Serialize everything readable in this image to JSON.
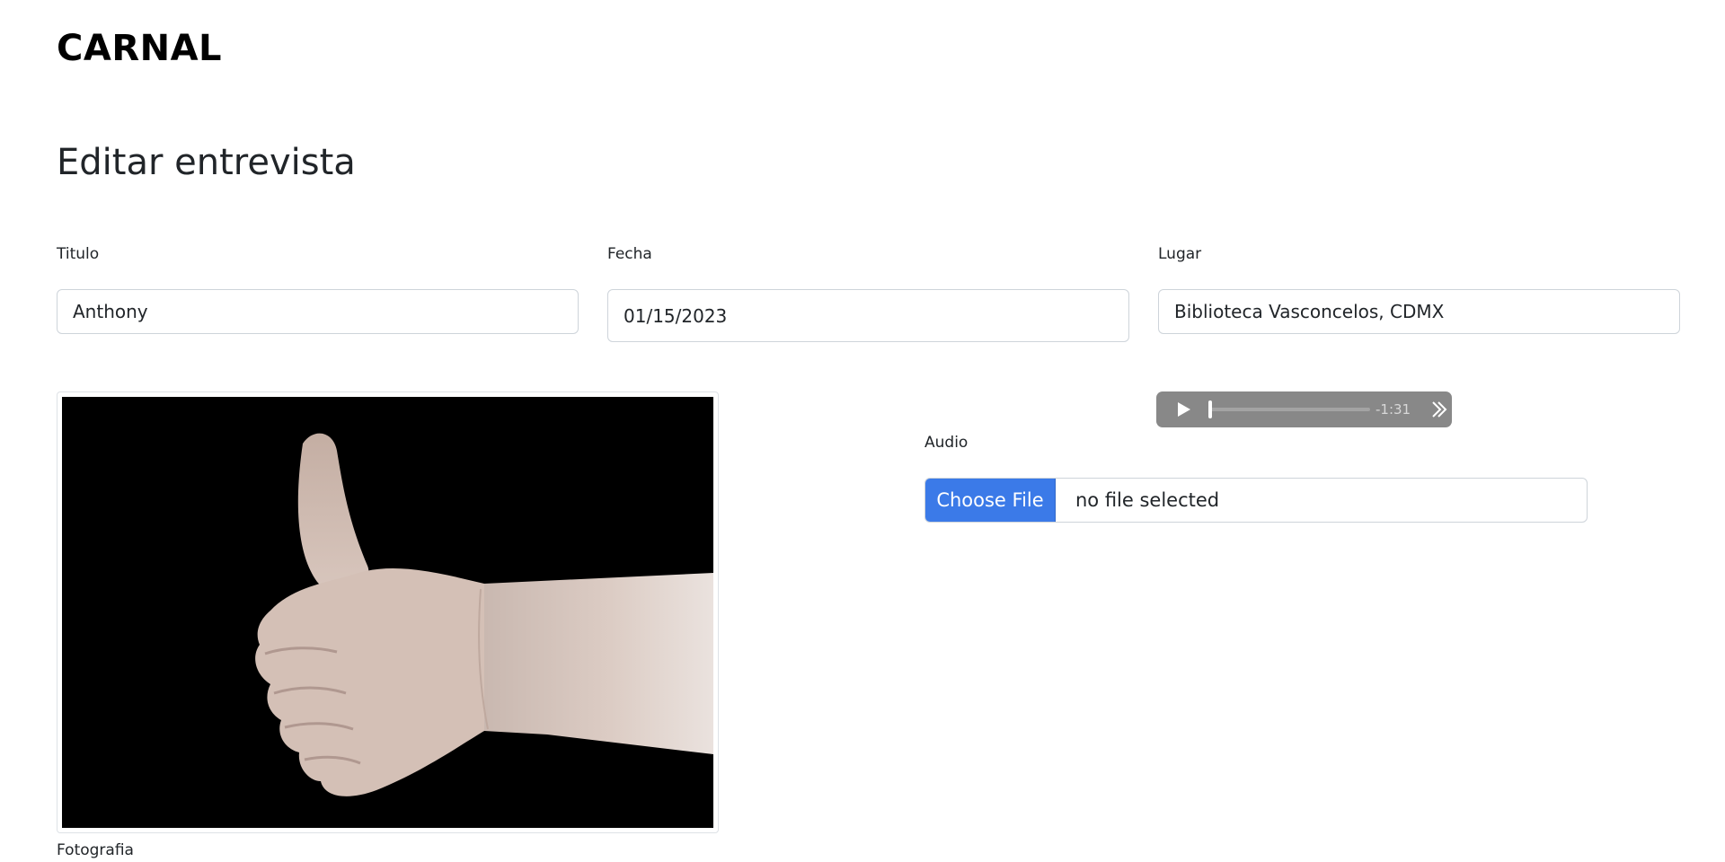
{
  "brand": {
    "logo_text": "CARNAL"
  },
  "page": {
    "title": "Editar entrevista"
  },
  "form": {
    "titulo": {
      "label": "Titulo",
      "value": "Anthony"
    },
    "fecha": {
      "label": "Fecha",
      "value": "01/15/2023"
    },
    "lugar": {
      "label": "Lugar",
      "value": "Biblioteca Vasconcelos, CDMX"
    },
    "fotografia": {
      "label": "Fotografia",
      "image_subject": "thumbs-up-hand-photo"
    },
    "audio": {
      "label": "Audio",
      "player": {
        "time_remaining": "-1:31",
        "progress_fraction": 0,
        "play_icon": "play-icon",
        "skip_icon": "fast-forward-icon"
      },
      "file_input": {
        "button_label": "Choose File",
        "status_text": "no file selected"
      }
    }
  },
  "colors": {
    "choose_file_button": "#3b7ae8",
    "audio_player_bg": "#888888",
    "input_border": "#ced4da"
  }
}
